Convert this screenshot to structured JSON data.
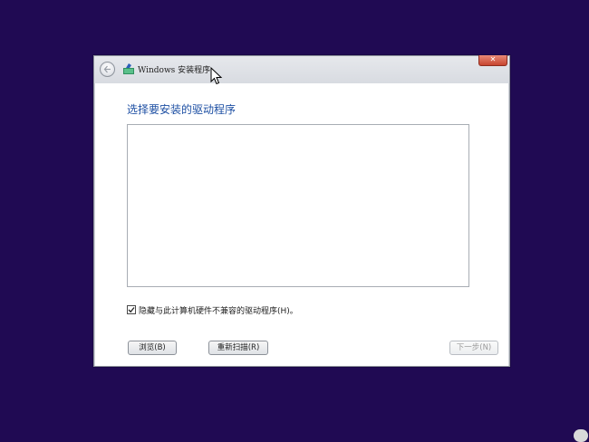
{
  "window": {
    "title": "Windows 安装程序",
    "close_label": "✕"
  },
  "page": {
    "heading": "选择要安装的驱动程序"
  },
  "hide_incompatible": {
    "label": "隐藏与此计算机硬件不兼容的驱动程序(H)。",
    "checked": true
  },
  "buttons": {
    "browse": "浏览(B)",
    "rescan": "重新扫描(R)",
    "next": "下一步(N)"
  },
  "colors": {
    "desktop_background": "#200a53",
    "heading_text": "#1d4fa3",
    "dialog_chrome": "#cfd3da",
    "close_button": "#c7452f"
  },
  "icons": {
    "back": "back-arrow-icon",
    "app": "windows-setup-icon",
    "close": "close-icon",
    "check": "check-icon",
    "cursor": "mouse-pointer-icon"
  }
}
